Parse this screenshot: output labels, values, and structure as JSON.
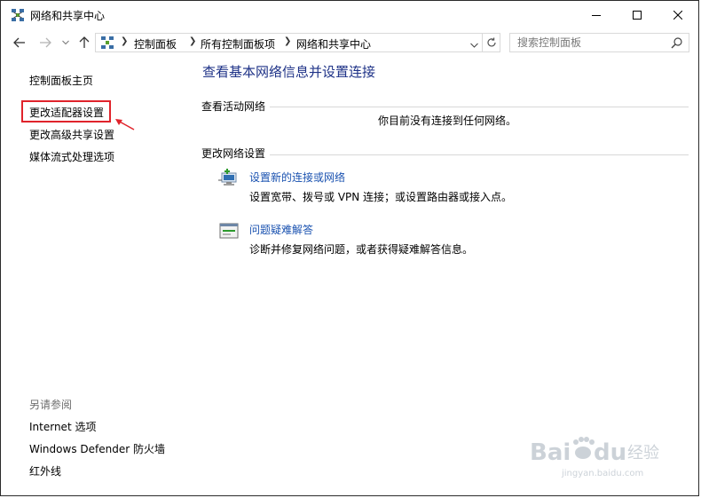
{
  "window": {
    "title": "网络和共享中心",
    "controls": {
      "minimize": "minimize-icon",
      "maximize": "maximize-icon",
      "close": "close-icon"
    }
  },
  "nav": {
    "back": "back-arrow-icon",
    "forward": "forward-arrow-icon",
    "up": "up-arrow-icon",
    "breadcrumb": [
      "控制面板",
      "所有控制面板项",
      "网络和共享中心"
    ],
    "search_placeholder": "搜索控制面板"
  },
  "sidebar": {
    "items": [
      {
        "label": "控制面板主页"
      },
      {
        "label": "更改适配器设置",
        "highlighted": true
      },
      {
        "label": "更改高级共享设置"
      },
      {
        "label": "媒体流式处理选项"
      }
    ],
    "see_also_heading": "另请参阅",
    "see_also": [
      {
        "label": "Internet 选项"
      },
      {
        "label": "Windows Defender 防火墙"
      },
      {
        "label": "红外线"
      }
    ]
  },
  "main": {
    "title": "查看基本网络信息并设置连接",
    "active_networks_heading": "查看活动网络",
    "no_network_message": "你目前没有连接到任何网络。",
    "change_settings_heading": "更改网络设置",
    "tasks": [
      {
        "link": "设置新的连接或网络",
        "description": "设置宽带、拨号或 VPN 连接；或设置路由器或接入点。",
        "icon": "new-connection-icon"
      },
      {
        "link": "问题疑难解答",
        "description": "诊断并修复网络问题，或者获得疑难解答信息。",
        "icon": "troubleshoot-icon"
      }
    ]
  },
  "watermark": {
    "brand": "Baidu经验",
    "url": "jingyan.baidu.com"
  },
  "colors": {
    "link": "#1a52b0",
    "title": "#1e3287",
    "highlight": "#e0232b"
  }
}
